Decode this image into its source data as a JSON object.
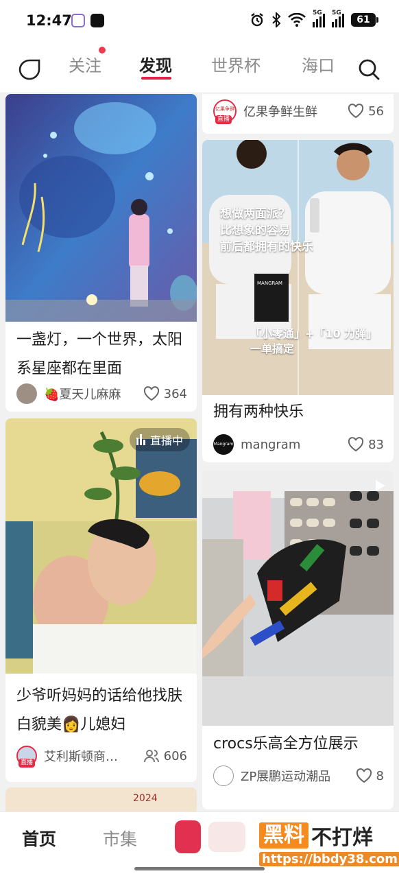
{
  "status_bar": {
    "time": "12:47",
    "signal_label_1": "5G",
    "signal_label_2": "5G",
    "battery": "61"
  },
  "top_nav": {
    "tabs": [
      {
        "label": "关注",
        "active": false,
        "has_dot": true
      },
      {
        "label": "发现",
        "active": true
      },
      {
        "label": "世界杯",
        "active": false
      },
      {
        "label": "海口",
        "active": false
      }
    ],
    "accent_color": "#e0244b"
  },
  "feed": {
    "left": [
      {
        "title": "一盏灯，一个世界，太阳系星座都在里面",
        "author": "🍓夏天儿麻麻",
        "likes": "364"
      },
      {
        "live_label": "直播中",
        "title": "少爷听妈妈的话给他找肤白貌美👩儿媳妇",
        "author": "艾利斯顿商…",
        "viewers": "606",
        "live_tag": "直播"
      },
      {
        "cover_text": "2024"
      }
    ],
    "right": [
      {
        "author": "亿果争鲜生鲜",
        "likes": "56",
        "live_tag": "直播",
        "avatar_text": "亿果争鲜"
      },
      {
        "cover_text_1": "想做两面派？",
        "cover_text_2": "比想象的容易",
        "cover_text_3": "前后都拥有的快乐",
        "cover_text_4": "「小零通」+「10 力弹」",
        "cover_text_5": "一单搞定",
        "product_label": "MANGRAM",
        "title": "拥有两种快乐",
        "author": "mangram",
        "avatar_text": "Mangram",
        "likes": "83"
      },
      {
        "title": "crocs乐高全方位展示",
        "author": "ZP展鹏运动潮品",
        "likes": "8"
      }
    ]
  },
  "bottom_bar": {
    "tabs": [
      "首页",
      "市集"
    ],
    "active_index": 0
  },
  "watermark": {
    "highlight": "黑料",
    "rest": "不打烊",
    "url": "https://bbdy38.com"
  }
}
